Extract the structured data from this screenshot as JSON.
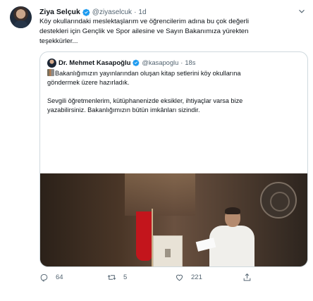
{
  "tweet": {
    "name": "Ziya Selçuk",
    "handle": "@ziyaselcuk",
    "separator": "·",
    "time": "1d",
    "text_lines": [
      "Köy okullarındaki meslektaşlarım ve öğrencilerim adına bu çok değerli",
      "destekleri için Gençlik ve Spor ailesine ve Sayın Bakanımıza yürekten",
      "teşekkürler..."
    ],
    "quoted": {
      "name": "Dr. Mehmet Kasapoğlu",
      "handle": "@kasapoglu",
      "separator": "·",
      "time": "18s",
      "text_lines": [
        "Bakanlığımızın yayınlarından oluşan kitap setlerini köy okullarına",
        "göndermek üzere hazırladık."
      ],
      "text_lines_2": [
        "Sevgili öğretmenlerim, kütüphanenizde eksikler, ihtiyaçlar varsa bize",
        "yazabilirsiniz. Bakanlığımızın bütün imkânları sizindir."
      ]
    },
    "actions": {
      "replies": "64",
      "retweets": "5",
      "likes": "221"
    }
  },
  "colors": {
    "verified": "#1d9bf0",
    "muted": "#536471",
    "border": "#cfd9de",
    "flag": "#c3151c"
  },
  "icons": [
    "verified-badge-icon",
    "chevron-down-icon",
    "reply-icon",
    "retweet-icon",
    "like-icon",
    "share-icon",
    "books-emoji-icon"
  ]
}
